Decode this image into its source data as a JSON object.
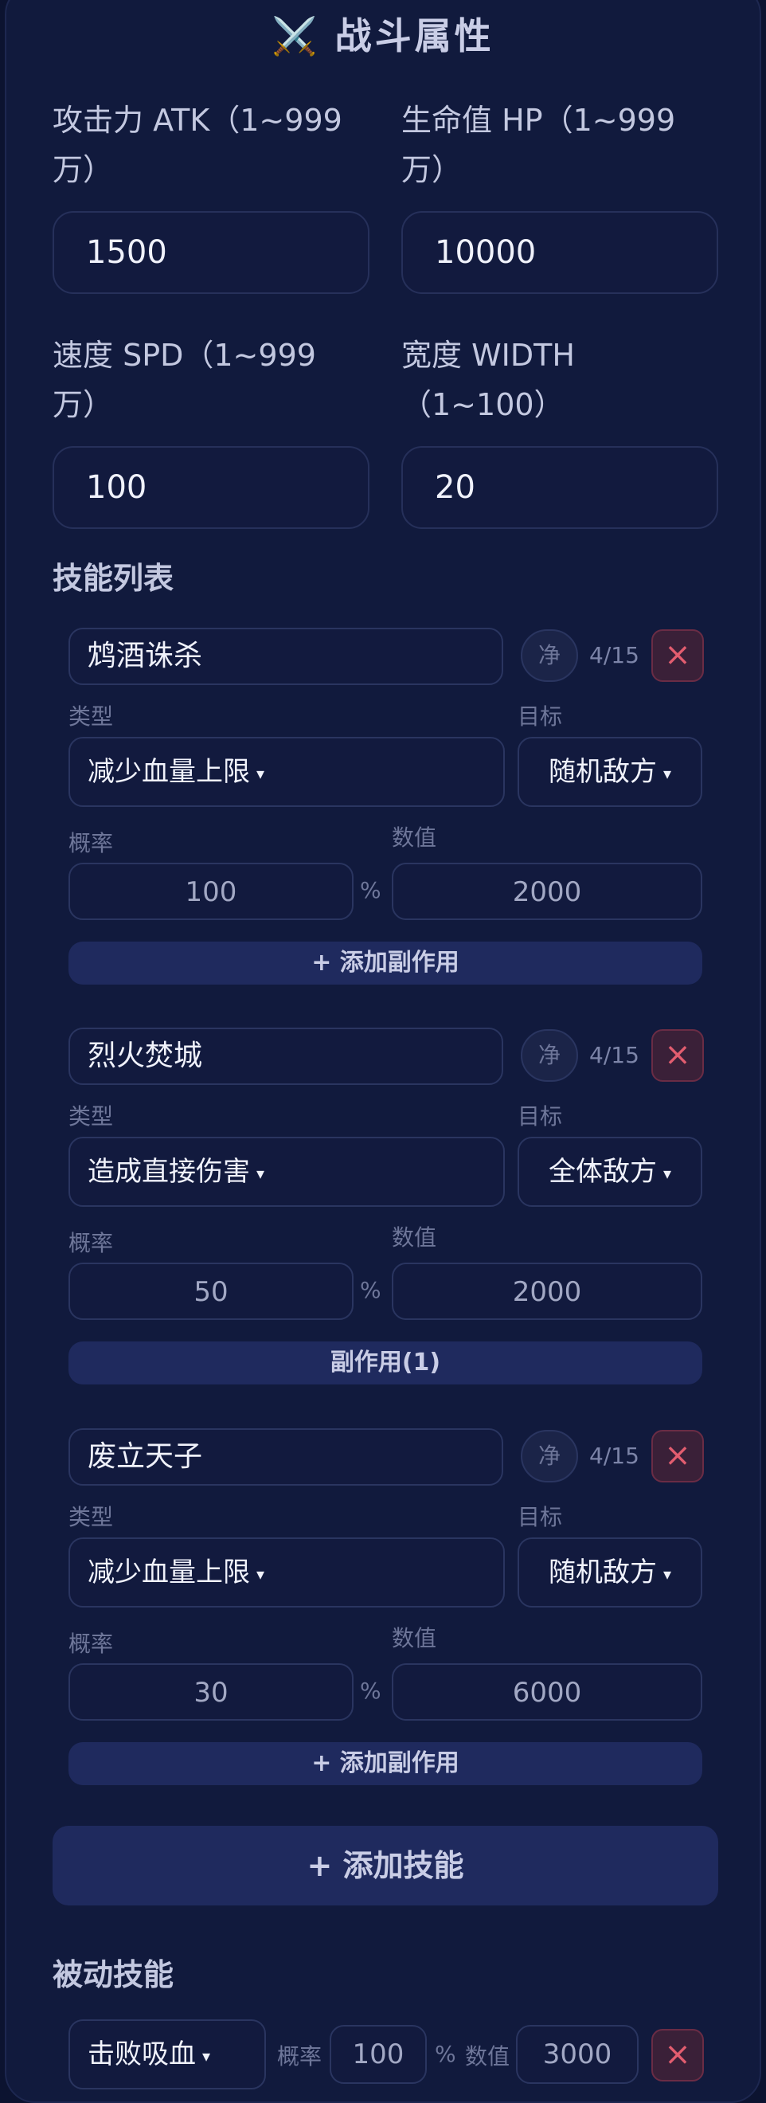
{
  "header": {
    "icon": "crossed-swords-icon",
    "title": "战斗属性",
    "swords_glyph": "⚔️"
  },
  "fields": {
    "atk": {
      "label_line1": "攻击力 ATK（1~999",
      "label_line2": "万）",
      "value": "1500"
    },
    "hp": {
      "label_line1": "生命值 HP（1~999",
      "label_line2": "万）",
      "value": "10000"
    },
    "spd": {
      "label_line1": "速度 SPD（1~999",
      "label_line2": "万）",
      "value": "100"
    },
    "width": {
      "label_line1": "宽度 WIDTH",
      "label_line2": "（1~100）",
      "value": "20"
    }
  },
  "skills_section": {
    "title": "技能列表"
  },
  "labels": {
    "type": "类型",
    "target": "目标",
    "chance": "概率",
    "value": "数值",
    "percent": "%",
    "clean_button": "净",
    "close_glyph": "×",
    "caret": "▾"
  },
  "skills": [
    {
      "name": "鸩酒诛杀",
      "count": "4/15",
      "type": "减少血量上限",
      "target": "随机敌方",
      "chance": "100",
      "value": "2000",
      "side_button": "+ 添加副作用"
    },
    {
      "name": "烈火焚城",
      "count": "4/15",
      "type": "造成直接伤害",
      "target": "全体敌方",
      "chance": "50",
      "value": "2000",
      "side_button": "副作用(1)"
    },
    {
      "name": "废立天子",
      "count": "4/15",
      "type": "减少血量上限",
      "target": "随机敌方",
      "chance": "30",
      "value": "6000",
      "side_button": "+ 添加副作用"
    }
  ],
  "add_skill_button": "+ 添加技能",
  "passive_section": {
    "title": "被动技能"
  },
  "passive": {
    "type": "击败吸血",
    "chance_label": "概率",
    "chance": "100",
    "percent": "%",
    "value_label": "数值",
    "value": "3000"
  },
  "colors": {
    "background": "#0c1330",
    "card": "#111a3d",
    "accent_button": "#1f2a5e",
    "danger": "#e25d6f"
  }
}
